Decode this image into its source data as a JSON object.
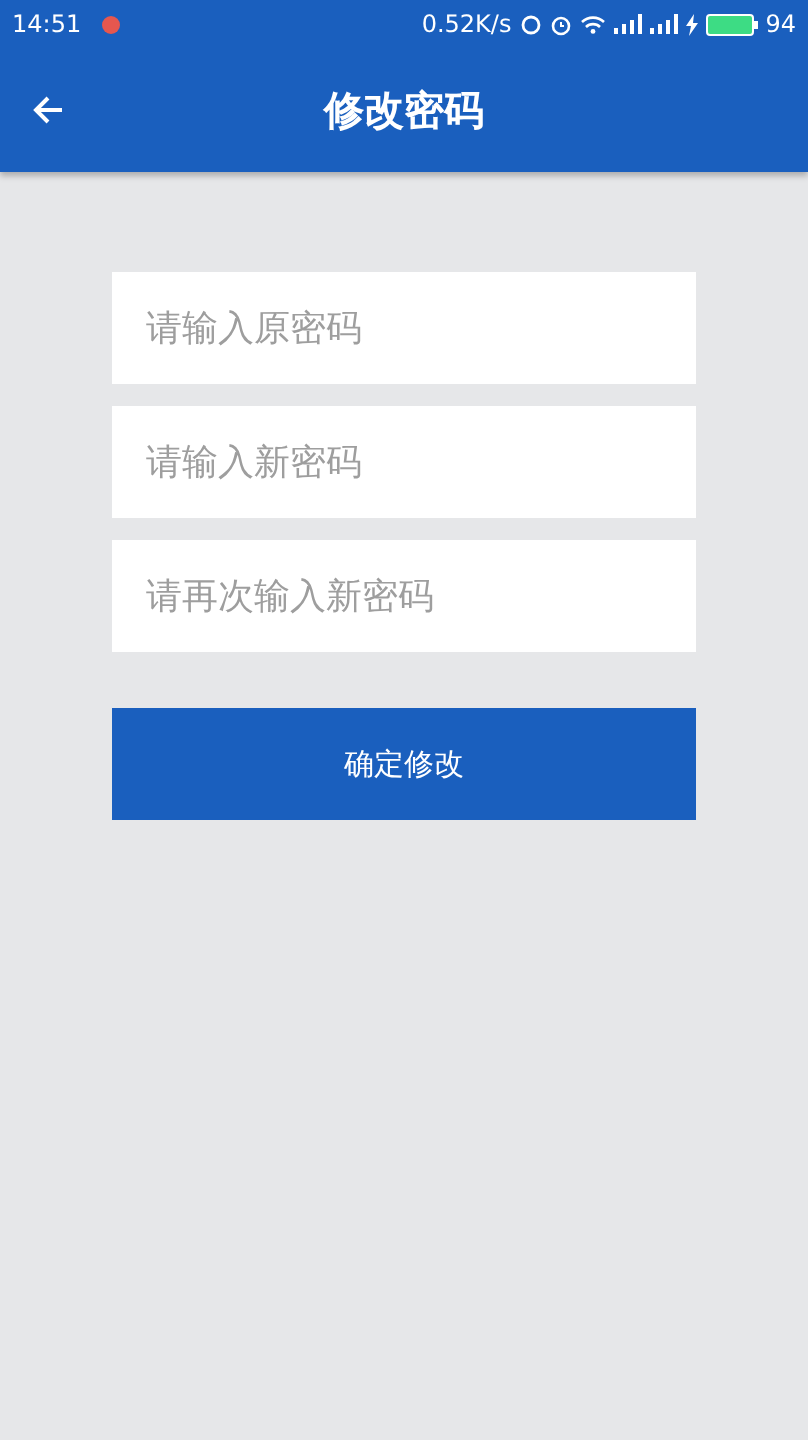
{
  "status_bar": {
    "time": "14:51",
    "speed": "0.52K/s",
    "battery": "94"
  },
  "app_bar": {
    "title": "修改密码"
  },
  "fields": [
    {
      "placeholder": "请输入原密码"
    },
    {
      "placeholder": "请输入新密码"
    },
    {
      "placeholder": "请再次输入新密码"
    }
  ],
  "submit_button": {
    "label": "确定修改"
  }
}
